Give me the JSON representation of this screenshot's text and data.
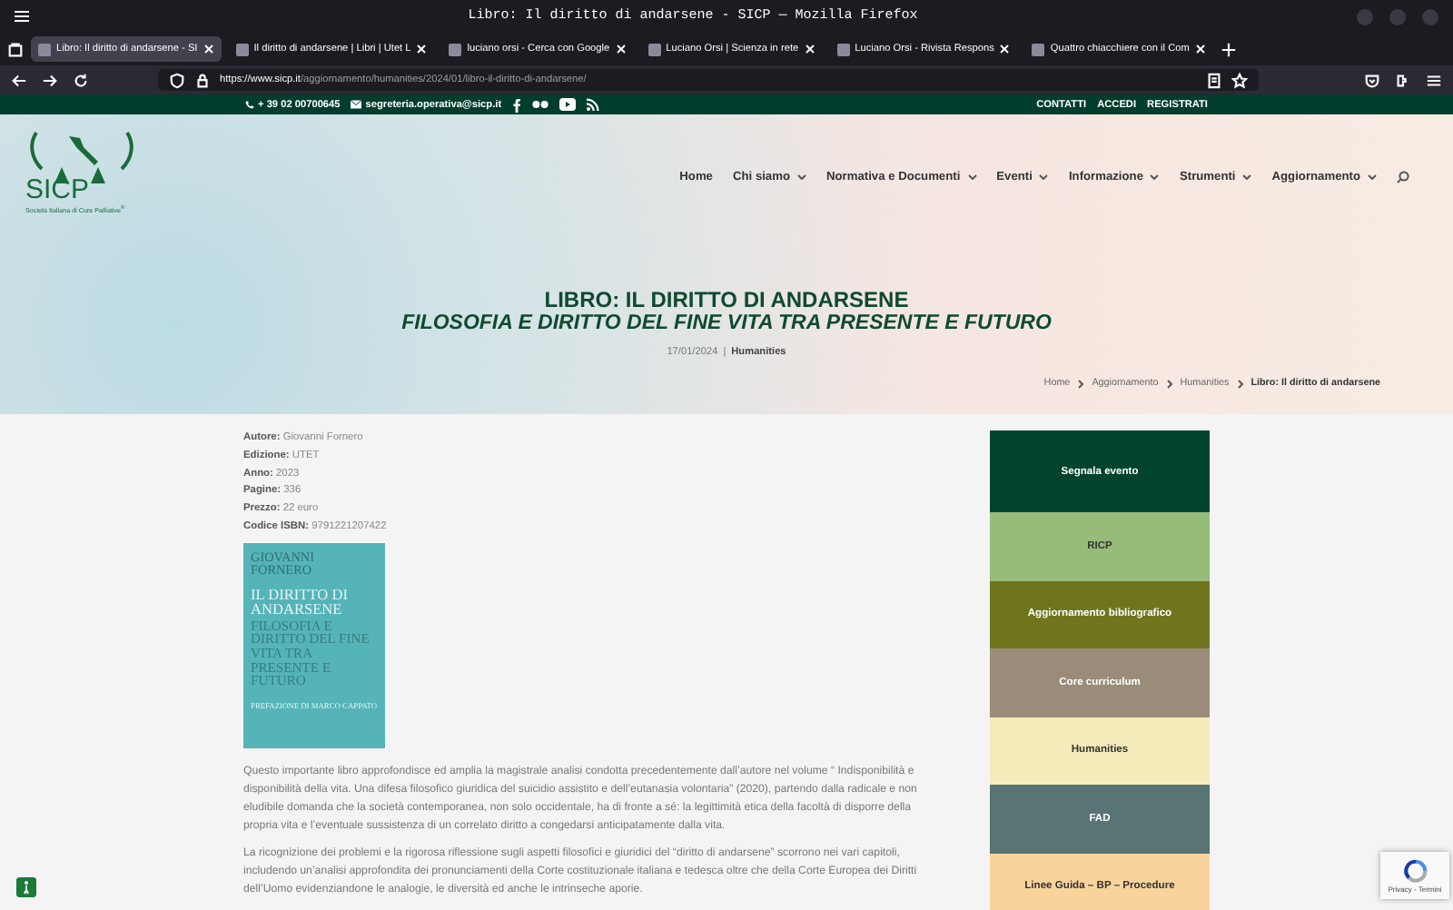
{
  "browser": {
    "title": "Libro: Il diritto di andarsene - SICP — Mozilla Firefox",
    "tabs": [
      {
        "label": "Libro: Il diritto di andarsene - SI",
        "selected": true
      },
      {
        "label": "Il diritto di andarsene | Libri | Utet L",
        "selected": false
      },
      {
        "label": "luciano orsi - Cerca con Google",
        "selected": false
      },
      {
        "label": "Luciano Orsi | Scienza in rete",
        "selected": false
      },
      {
        "label": "Luciano Orsi - Rivista Respons",
        "selected": false
      },
      {
        "label": "Quattro chiacchiere con il Com",
        "selected": false
      }
    ],
    "url_host": "https://www.sicp.it",
    "url_path": "/aggiornamento/humanities/2024/01/libro-il-diritto-di-andarsene/"
  },
  "top_bar": {
    "phone": "+ 39 02 00700645",
    "email": "segreteria.operativa@sicp.it",
    "links": [
      "CONTATTI",
      "ACCEDI",
      "REGISTRATI"
    ]
  },
  "logo": {
    "name": "SICP",
    "tagline": "Società Italiana di Cure Palliative$^{®}$"
  },
  "nav": [
    {
      "label": "Home",
      "has_menu": false
    },
    {
      "label": "Chi siamo",
      "has_menu": true
    },
    {
      "label": "Normativa e Documenti",
      "has_menu": true
    },
    {
      "label": "Eventi",
      "has_menu": true
    },
    {
      "label": "Informazione",
      "has_menu": true
    },
    {
      "label": "Strumenti",
      "has_menu": true
    },
    {
      "label": "Aggiornamento",
      "has_menu": true
    }
  ],
  "hero": {
    "title": "LIBRO: IL DIRITTO DI ANDARSENE",
    "subtitle": "FILOSOFIA E DIRITTO DEL FINE VITA TRA PRESENTE E FUTURO",
    "date": "17/01/2024",
    "separator": "|",
    "category": "Humanities",
    "breadcrumbs": [
      "Home",
      "Aggiornamento",
      "Humanities",
      "Libro: Il diritto di andarsene"
    ]
  },
  "details": [
    {
      "label": "Autore:",
      "value": "Giovanni Fornero"
    },
    {
      "label": "Edizione:",
      "value": "UTET"
    },
    {
      "label": "Anno:",
      "value": "2023"
    },
    {
      "label": "Pagine:",
      "value": "336"
    },
    {
      "label": "Prezzo:",
      "value": "22 euro"
    },
    {
      "label": "Codice ISBN:",
      "value": "9791221207422"
    }
  ],
  "book_cover": {
    "author": "GIOVANNI FORNERO",
    "title": "IL DIRITTO DI ANDARSENE",
    "subtitle": "FILOSOFIA E DIRITTO DEL FINE VITA TRA PRESENTE E FUTURO",
    "preface": "PREFAZIONE DI MARCO CAPPATO"
  },
  "paragraphs": [
    "Questo importante libro approfondisce ed amplia la magistrale analisi condotta precedentemente dall’autore nel volume “ Indisponibilità e disponibilità della vita. Una difesa filosofico giuridica del suicidio assistito e dell’eutanasia volontaria” (2020), partendo dalla radicale e non eludibile domanda che la società contemporanea, non solo occidentale, ha di fronte a sé: la legittimità etica della facoltà di disporre della propria vita e l’eventuale sussistenza di un correlato diritto a congedarsi anticipatamente dalla vita.",
    "La ricognizione dei problemi e la rigorosa riflessione sugli aspetti filosofici e giuridici del “diritto di andarsene” scorrono nei vari capitoli, includendo un’analisi approfondita dei pronunciamenti della Corte costituzionale italiana e tedesca oltre che della Corte Europea dei Diritti dell’Uomo evidenziandone le analogie, le diversità ed anche le intrinseche aporie."
  ],
  "sidebar": [
    {
      "label": "Segnala evento",
      "color": "#00432f"
    },
    {
      "label": "RICP",
      "color": "#97bb78"
    },
    {
      "label": "Aggiornamento bibliografico",
      "color": "#6f751d"
    },
    {
      "label": "Core curriculum",
      "color": "#9a8c78"
    },
    {
      "label": "Humanities",
      "color": "#f5ebbb"
    },
    {
      "label": "FAD",
      "color": "#587474"
    },
    {
      "label": "Linee Guida – BP – Procedure",
      "color": "#f8d49c"
    }
  ],
  "recaptcha": {
    "links": "Privacy - Termini"
  }
}
